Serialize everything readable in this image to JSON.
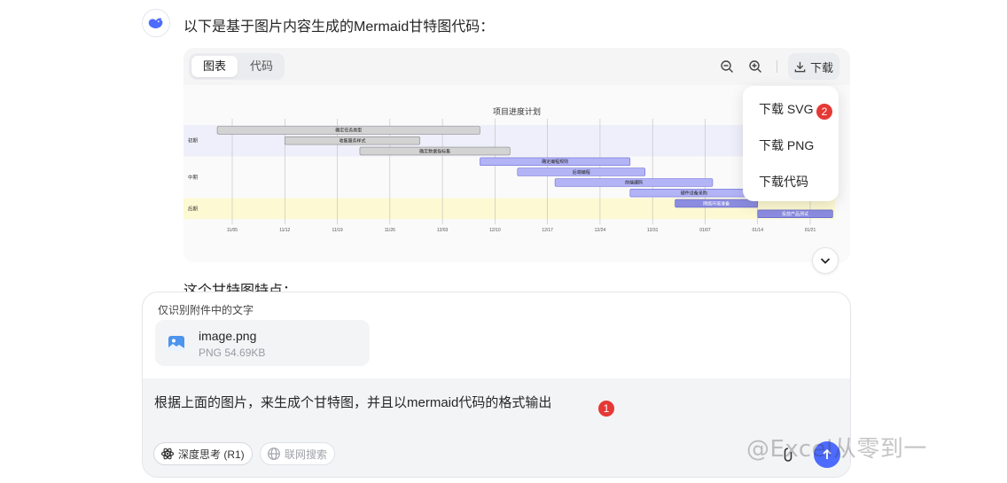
{
  "intro_text": "以下是基于图片内容生成的Mermaid甘特图代码：",
  "toolbar": {
    "tab_chart": "图表",
    "tab_code": "代码",
    "zoom_out_icon": "zoom-out-icon",
    "zoom_in_icon": "zoom-in-icon",
    "download_label": "下载"
  },
  "download_menu": {
    "items": [
      "下载 SVG",
      "下载 PNG",
      "下载代码"
    ],
    "badge": "2"
  },
  "chart_data": {
    "type": "gantt",
    "title": "项目进度计划",
    "sections": [
      {
        "name": "初期",
        "tasks": [
          {
            "name": "确定任务类型",
            "start": "2023-11-03",
            "end": "2023-12-08"
          },
          {
            "name": "收集服务样式",
            "start": "2023-11-12",
            "end": "2023-11-30"
          },
          {
            "name": "确定数据指标集",
            "start": "2023-11-22",
            "end": "2023-12-12"
          }
        ]
      },
      {
        "name": "中期",
        "tasks": [
          {
            "name": "确定编程规则",
            "start": "2023-12-08",
            "end": "2023-12-28"
          },
          {
            "name": "后端编程",
            "start": "2023-12-13",
            "end": "2023-12-30"
          },
          {
            "name": "前端编码",
            "start": "2023-12-18",
            "end": "2024-01-08"
          },
          {
            "name": "硬件设备采购",
            "start": "2023-12-28",
            "end": "2024-01-14"
          }
        ]
      },
      {
        "name": "后期",
        "tasks": [
          {
            "name": "网络环境准备",
            "start": "2024-01-03",
            "end": "2024-01-14"
          },
          {
            "name": "投放产品测试",
            "start": "2024-01-14",
            "end": "2024-01-24"
          }
        ]
      }
    ],
    "x_ticks": [
      "11/05",
      "11/12",
      "11/19",
      "11/26",
      "12/03",
      "12/10",
      "12/17",
      "12/24",
      "12/31",
      "01/07",
      "01/14",
      "01/21"
    ],
    "tick_dates": [
      "2023-11-05",
      "2023-11-12",
      "2023-11-19",
      "2023-11-26",
      "2023-12-03",
      "2023-12-10",
      "2023-12-17",
      "2023-12-24",
      "2023-12-31",
      "2024-01-07",
      "2024-01-14",
      "2024-01-21"
    ],
    "colors": {
      "section1_bg": "#efeffb",
      "section2_bg": "#fafafa",
      "section3_bg": "#fdf9d2",
      "section1_bar": "#d3d3d3",
      "section2_bar": "#b3b4f6",
      "section3_bar": "#8b8ce0"
    }
  },
  "continued_text": "这个甘特图特点：",
  "composer": {
    "hint": "仅识别附件中的文字",
    "attachment": {
      "name": "image.png",
      "meta": "PNG 54.69KB"
    },
    "input_value": "根据上面的图片，来生成个甘特图，并且以mermaid代码的格式输出",
    "input_badge": "1",
    "deep_think_label": "深度思考 (R1)",
    "web_search_label": "联网搜索"
  },
  "watermark": "@Excel从零到一",
  "colors": {
    "accent": "#4d6bfe",
    "badge": "#e53935"
  }
}
